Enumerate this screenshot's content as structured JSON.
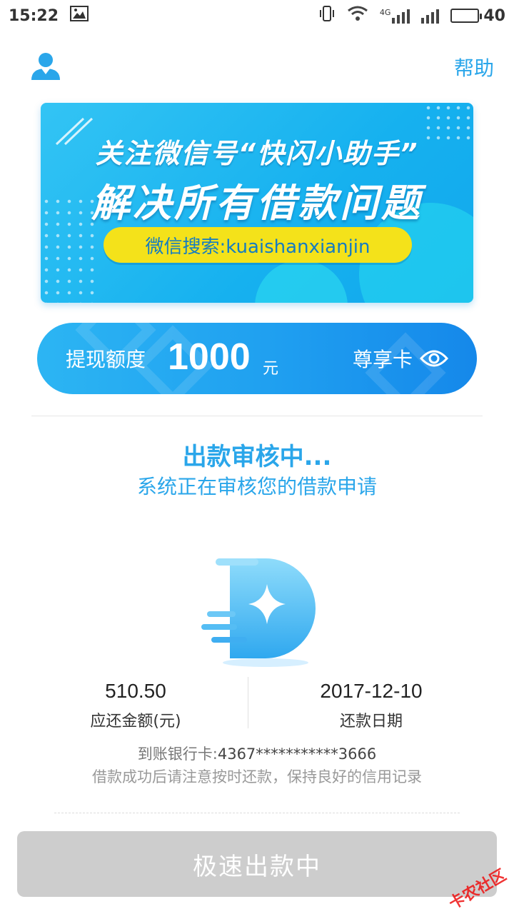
{
  "status_bar": {
    "time": "15:22",
    "network": "4G",
    "battery": "40",
    "battery_level": 0.4
  },
  "header": {
    "help_label": "帮助"
  },
  "banner": {
    "line1": "关注微信号“快闪小助手”",
    "line2": "解决所有借款问题",
    "pill": "微信搜索:kuaishanxianjin"
  },
  "credit": {
    "label": "提现额度",
    "amount": "1000",
    "unit": "元",
    "card_type": "尊享卡"
  },
  "status": {
    "title": "出款审核中...",
    "subtitle": "系统正在审核您的借款申请"
  },
  "repayment": {
    "amount": "510.50",
    "amount_label": "应还金额(元)",
    "date": "2017-12-10",
    "date_label": "还款日期"
  },
  "bank": {
    "label": "到账银行卡:",
    "number": "4367***********3666"
  },
  "notice": "借款成功后请注意按时还款，保持良好的信用记录",
  "main_button": "极速出款中",
  "watermark": "卡农社区",
  "colors": {
    "accent": "#2aa6ea",
    "banner_pill": "#f4e21a",
    "button_disabled": "#cdcdcd"
  }
}
